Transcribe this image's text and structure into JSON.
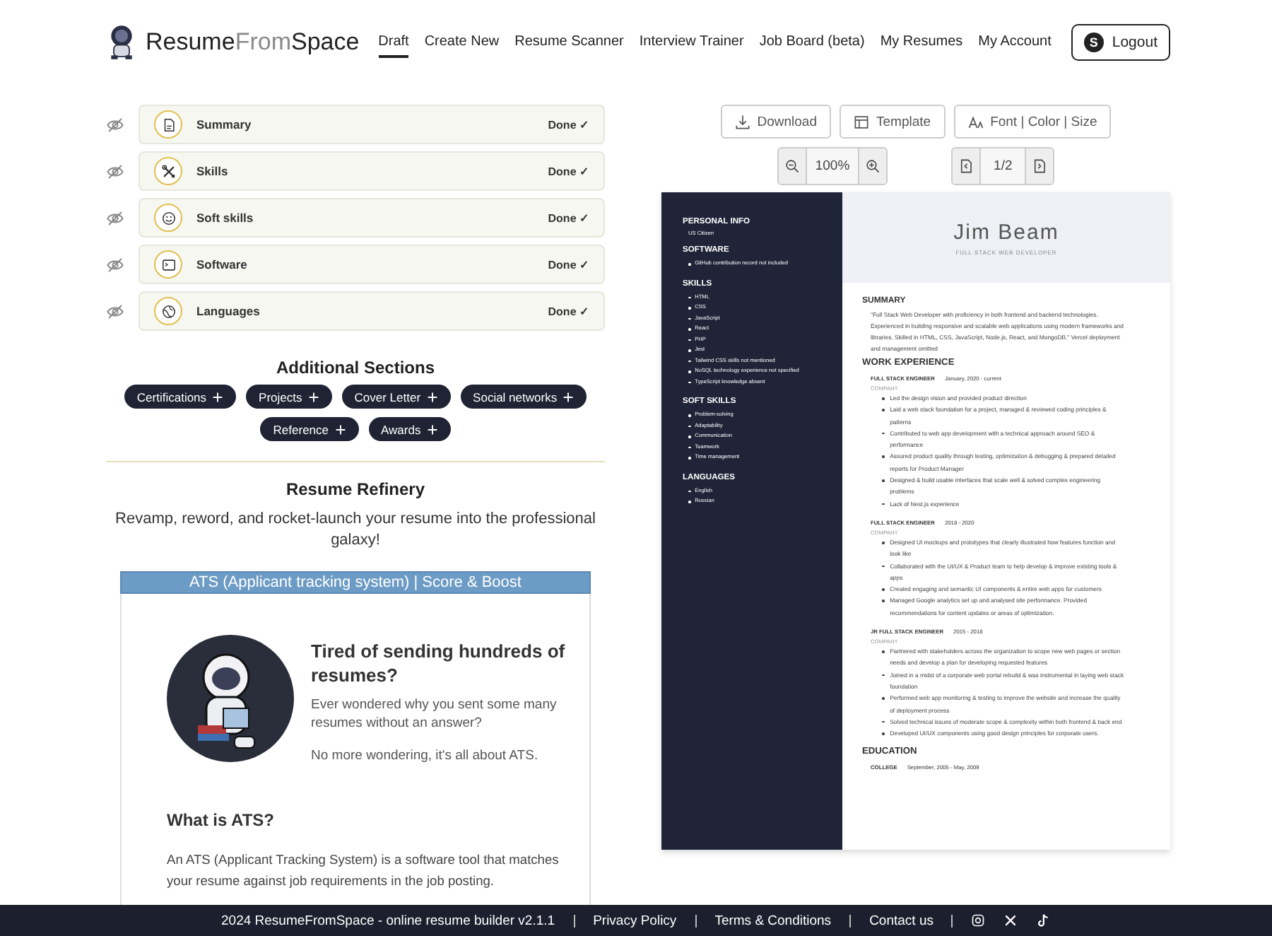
{
  "header": {
    "logo": [
      {
        "text": "Resume",
        "muted": false
      },
      {
        "text": "From",
        "muted": true
      },
      {
        "text": "Space",
        "muted": false
      }
    ],
    "nav": [
      {
        "label": "Draft",
        "selected": true
      },
      {
        "label": "Create New",
        "selected": false
      },
      {
        "label": "Resume Scanner",
        "selected": false
      },
      {
        "label": "Interview Trainer",
        "selected": false
      },
      {
        "label": "Job Board (beta)",
        "selected": false
      },
      {
        "label": "My Resumes",
        "selected": false
      },
      {
        "label": "My Account",
        "selected": false
      }
    ],
    "logout": {
      "avatar": "S",
      "label": "Logout"
    }
  },
  "sections": [
    {
      "title": "Summary",
      "kind": "document",
      "status": "Done ✓"
    },
    {
      "title": "Skills",
      "kind": "tools",
      "status": "Done ✓"
    },
    {
      "title": "Soft skills",
      "kind": "smile",
      "status": "Done ✓"
    },
    {
      "title": "Software",
      "kind": "terminal",
      "status": "Done ✓"
    },
    {
      "title": "Languages",
      "kind": "globe",
      "status": "Done ✓"
    }
  ],
  "additional": {
    "title": "Additional Sections",
    "items": [
      "Certifications",
      "Projects",
      "Cover Letter",
      "Social networks",
      "Reference",
      "Awards"
    ]
  },
  "refinery": {
    "title": "Resume Refinery",
    "subtitle": "Revamp, reword, and rocket-launch your resume into the professional galaxy!",
    "ats_button": "ATS (Applicant tracking system) | Score & Boost",
    "card": {
      "heading": "Tired of sending hundreds of resumes?",
      "lines": [
        "Ever wondered why you sent some many resumes without an answer?",
        "No more wondering, it's all about ATS."
      ],
      "question": "What is ATS?",
      "answer": "An ATS (Applicant Tracking System) is a software tool that matches your resume against job requirements in the job posting."
    }
  },
  "toolbar": {
    "buttons": [
      {
        "kind": "download",
        "label": "Download"
      },
      {
        "kind": "template",
        "label": "Template"
      },
      {
        "kind": "font",
        "label": "Font | Color | Size"
      }
    ],
    "zoom": "100%",
    "page": "1/2"
  },
  "resume": {
    "sidebar": [
      {
        "title": "PERSONAL INFO",
        "note": "US Citizen"
      },
      {
        "title": "SOFTWARE",
        "items": [
          "GitHub contribution record not included"
        ]
      },
      {
        "title": "SKILLS",
        "items": [
          "HTML",
          "CSS",
          "JavaScript",
          "React",
          "PHP",
          "Jest",
          "Tailwind CSS skills not mentioned",
          "NoSQL technology experience not specified",
          "TypeScript knowledge absent"
        ]
      },
      {
        "title": "SOFT SKILLS",
        "items": [
          "Problem-solving",
          "Adaptability",
          "Communication",
          "Teamwork",
          "Time management"
        ]
      },
      {
        "title": "LANGUAGES",
        "items": [
          "English",
          "Russian"
        ]
      }
    ],
    "name": "Jim Beam",
    "role": "FULL STACK WEB DEVELOPER",
    "summary_title": "SUMMARY",
    "summary": "\"Full Stack Web Developer with proficiency in both frontend and backend technologies. Experienced in building responsive and scalable web applications using modern frameworks and libraries. Skilled in HTML, CSS, JavaScript, Node.js, React, and MongoDB.\" Vercel deployment and management omitted",
    "work_title": "WORK EXPERIENCE",
    "jobs": [
      {
        "position": "FULL STACK ENGINEER",
        "dates": "January, 2020 - current",
        "company": "COMPANY",
        "bullets": [
          "Led the design vision and provided product direction",
          "Laid a web stack foundation for a project, managed & reviewed coding principles & patterns",
          "Contributed to web app development with a technical approach around SEO & performance",
          "Assured product quality through testing, optimization & debugging & prepared detailed reports for Product Manager",
          "Designed & build usable interfaces that scale well & solved complex engineering problems",
          "Lack of Nest.js experience"
        ]
      },
      {
        "position": "FULL STACK ENGINEER",
        "dates": "2018 - 2020",
        "company": "COMPANY",
        "bullets": [
          "Designed UI mockups and prototypes that clearly illustrated how features function and look like",
          "Collaborated with the UI/UX & Product team to help develop & improve existing tools & apps",
          "Created engaging and semantic UI components & entire web apps for customers",
          "Managed Google analytics set up and analysed site performance. Provided recommendations for content updates or areas of optimization."
        ]
      },
      {
        "position": "JR FULL STACK ENGINEER",
        "dates": "2015 - 2018",
        "company": "COMPANY",
        "bullets": [
          "Partnered with stakeholders across the organization to scope new web pages or section needs and develop a plan for developing requested features",
          "Joined in a midst of a corporate web portal rebuild & was instrumental in laying web stack foundation",
          "Performed web app monitoring & testing to improve the website and increase the quality of deployment process",
          "Solved technical issues of moderate scope & complexity within both frontend & back end",
          "Developed UI/UX components using good design principles for corporate users."
        ]
      }
    ],
    "education_title": "EDUCATION",
    "education": [
      {
        "school": "COLLEGE",
        "dates": "September, 2005 - May, 2009"
      }
    ]
  },
  "footer": {
    "text": "2024 ResumeFromSpace - online resume builder v2.1.1",
    "links": [
      "Privacy Policy",
      "Terms & Conditions",
      "Contact us"
    ],
    "socials": [
      {
        "kind": "instagram"
      },
      {
        "kind": "x"
      },
      {
        "kind": "tiktok"
      }
    ]
  }
}
